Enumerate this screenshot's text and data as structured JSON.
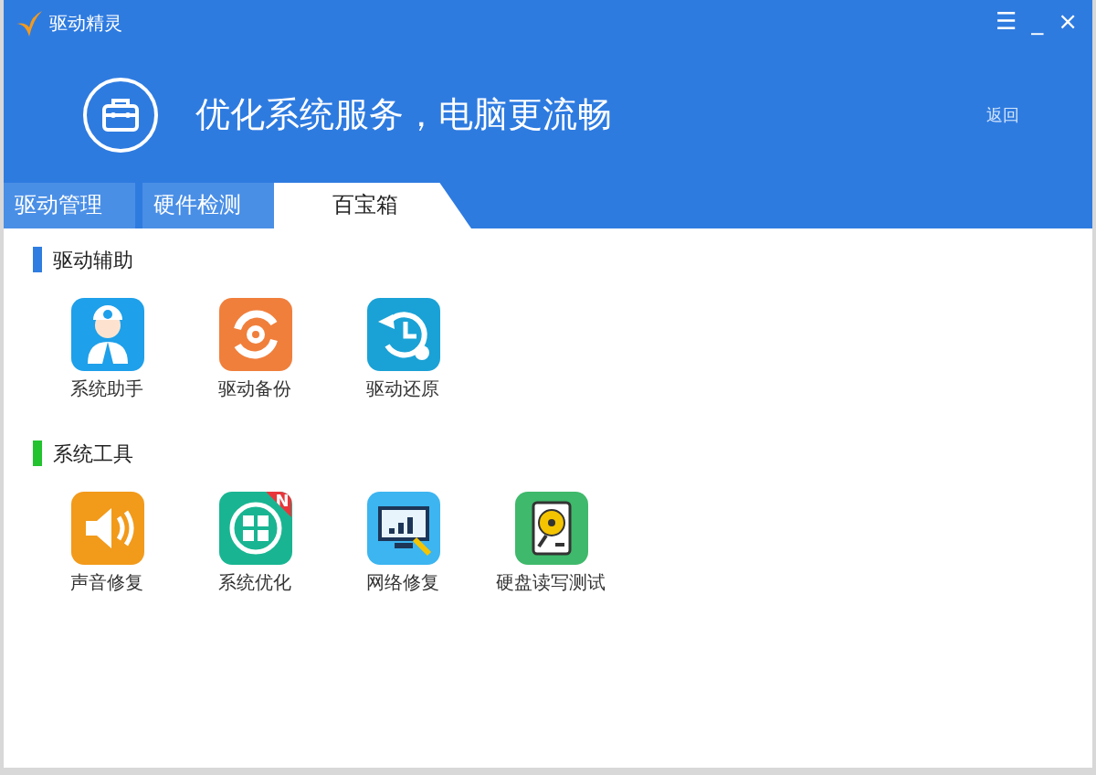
{
  "window": {
    "title": "驱动精灵",
    "controls": [
      "☰",
      "_",
      "×"
    ]
  },
  "banner": {
    "headline": "优化系统服务，电脑更流畅",
    "back_link": "返回"
  },
  "tabs": [
    {
      "label": "驱动管理",
      "selected": false
    },
    {
      "label": "硬件检测",
      "selected": false
    },
    {
      "label": "百宝箱",
      "selected": true
    }
  ],
  "sections": [
    {
      "title": "驱动辅助",
      "color": "#2f7de1",
      "tools": [
        {
          "label": "系统助手",
          "kind": "doctor",
          "color": "#1ea0ea"
        },
        {
          "label": "驱动备份",
          "kind": "backup",
          "color": "#f07f3c"
        },
        {
          "label": "驱动还原",
          "kind": "restore",
          "color": "#1aa2d6"
        }
      ]
    },
    {
      "title": "系统工具",
      "color": "#22c32e",
      "tools": [
        {
          "label": "声音修复",
          "kind": "sound",
          "color": "#f29a1a"
        },
        {
          "label": "系统优化",
          "kind": "optimize",
          "color": "#19b592",
          "badge": "N"
        },
        {
          "label": "网络修复",
          "kind": "network",
          "color": "#3cb5f0"
        },
        {
          "label": "硬盘读写测试",
          "kind": "disk",
          "color": "#3fb96b"
        }
      ]
    }
  ]
}
